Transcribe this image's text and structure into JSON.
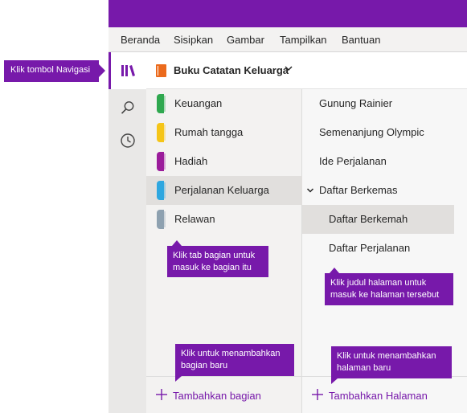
{
  "ribbon": {
    "menu": [
      "Beranda",
      "Sisipkan",
      "Gambar",
      "Tampilkan",
      "Bantuan"
    ]
  },
  "rail": {
    "items": [
      {
        "icon": "library-icon",
        "active": true
      },
      {
        "icon": "search-icon",
        "active": false
      },
      {
        "icon": "recent-icon",
        "active": false
      }
    ]
  },
  "notebook": {
    "title": "Buku Catatan Keluarga",
    "icon_color": "#eb6a1c"
  },
  "sections": [
    {
      "label": "Keuangan",
      "color": "#2fa84f",
      "selected": false
    },
    {
      "label": "Rumah tangga",
      "color": "#f5c518",
      "selected": false
    },
    {
      "label": "Hadiah",
      "color": "#9b1c9b",
      "selected": false
    },
    {
      "label": "Perjalanan Keluarga",
      "color": "#2ea7e0",
      "selected": true
    },
    {
      "label": "Relawan",
      "color": "#8ea1b0",
      "selected": false
    }
  ],
  "pages": [
    {
      "label": "Gunung Rainier",
      "level": 0,
      "selected": false
    },
    {
      "label": "Semenanjung Olympic",
      "level": 0,
      "selected": false
    },
    {
      "label": "Ide Perjalanan",
      "level": 0,
      "selected": false
    },
    {
      "label": "Daftar Berkemas",
      "level": 0,
      "selected": false,
      "expandable": true
    },
    {
      "label": "Daftar Berkemah",
      "level": 1,
      "selected": true
    },
    {
      "label": "Daftar Perjalanan",
      "level": 1,
      "selected": false
    }
  ],
  "add": {
    "section_label": "Tambahkan bagian",
    "page_label": "Tambahkan Halaman"
  },
  "callouts": {
    "nav": "Klik tombol Navigasi",
    "section_tab": "Klik tab bagian untuk masuk ke bagian itu",
    "page_title": "Klik judul halaman untuk masuk ke halaman tersebut",
    "add_section": "Klik untuk menambahkan bagian baru",
    "add_page": "Klik untuk menambahkan halaman baru"
  },
  "colors": {
    "accent": "#7719aa",
    "ribbon_bg": "#f3f2f1",
    "rail_bg": "#e9e8e7"
  }
}
